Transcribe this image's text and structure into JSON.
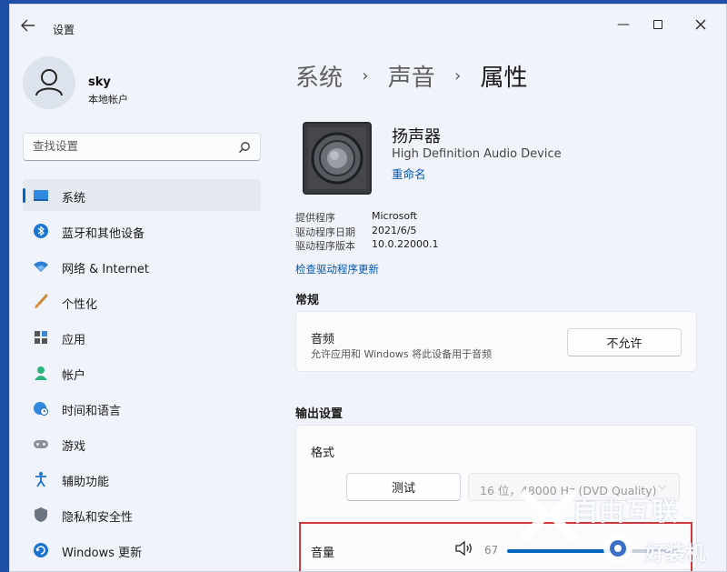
{
  "window": {
    "title": "设置"
  },
  "user": {
    "name": "sky",
    "type": "本地帐户"
  },
  "search": {
    "placeholder": "查找设置"
  },
  "nav": [
    {
      "label": "系统",
      "icon": "monitor-icon",
      "active": true
    },
    {
      "label": "蓝牙和其他设备",
      "icon": "bluetooth-icon"
    },
    {
      "label": "网络 & Internet",
      "icon": "wifi-icon"
    },
    {
      "label": "个性化",
      "icon": "brush-icon"
    },
    {
      "label": "应用",
      "icon": "apps-icon"
    },
    {
      "label": "帐户",
      "icon": "person-icon"
    },
    {
      "label": "时间和语言",
      "icon": "globe-clock-icon"
    },
    {
      "label": "游戏",
      "icon": "gamepad-icon"
    },
    {
      "label": "辅助功能",
      "icon": "accessibility-icon"
    },
    {
      "label": "隐私和安全性",
      "icon": "shield-icon"
    },
    {
      "label": "Windows 更新",
      "icon": "update-icon"
    }
  ],
  "breadcrumb": {
    "parts": [
      "系统",
      "声音",
      "属性"
    ]
  },
  "device": {
    "name": "扬声器",
    "description": "High Definition Audio Device",
    "rename_label": "重命名",
    "info": [
      {
        "key": "提供程序",
        "value": "Microsoft"
      },
      {
        "key": "驱动程序日期",
        "value": "2021/6/5"
      },
      {
        "key": "驱动程序版本",
        "value": "10.0.22000.1"
      }
    ],
    "check_driver_label": "检查驱动程序更新"
  },
  "general": {
    "section_title": "常规",
    "audio_title": "音频",
    "audio_desc": "允许应用和 Windows 将此设备用于音频",
    "disallow_button": "不允许"
  },
  "output": {
    "section_title": "输出设置",
    "format_title": "格式",
    "test_button": "测试",
    "format_value": "16 位，48000 Hz (DVD Quality)",
    "volume_label": "音量",
    "volume_value": "67",
    "volume_level": 0.67
  },
  "watermark": {
    "line1": "自由互联",
    "line2": "好装机"
  },
  "colors": {
    "accent": "#0067c0",
    "highlight_border": "#d0383c"
  }
}
